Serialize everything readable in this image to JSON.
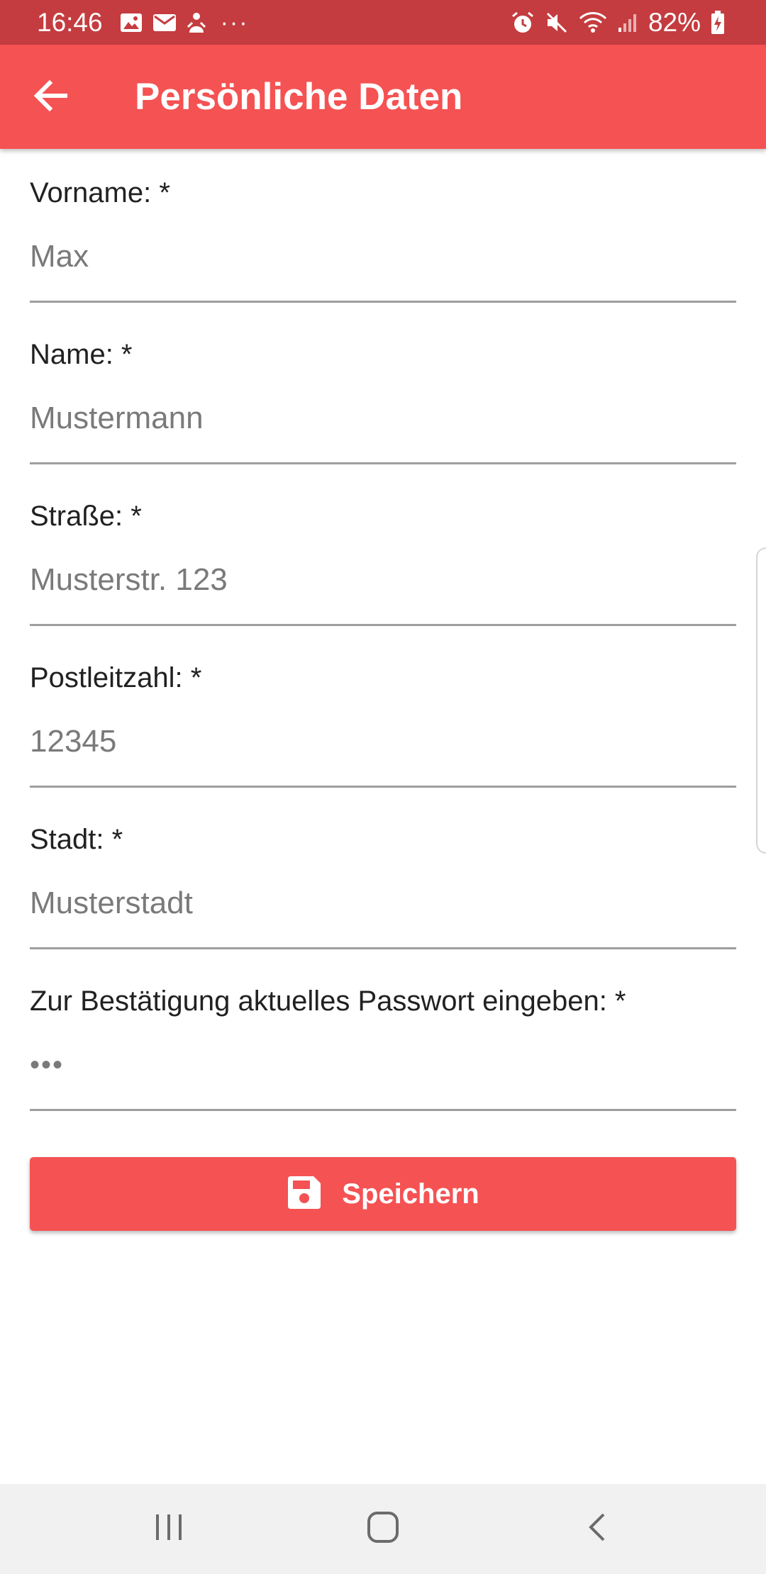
{
  "status_bar": {
    "time": "16:46",
    "battery": "82%",
    "left_icons": [
      "image-icon",
      "mail-icon",
      "notification-icon"
    ],
    "right_icons": [
      "alarm-icon",
      "mute-icon",
      "wifi-icon",
      "signal-icon",
      "battery-charging-icon"
    ]
  },
  "app_bar": {
    "title": "Persönliche Daten",
    "back_icon": "arrow-back-icon",
    "background": "#f55253"
  },
  "form": {
    "fields": [
      {
        "label": "Vorname: *",
        "value": "Max"
      },
      {
        "label": "Name: *",
        "value": "Mustermann"
      },
      {
        "label": "Straße: *",
        "value": "Musterstr. 123"
      },
      {
        "label": "Postleitzahl: *",
        "value": "12345"
      },
      {
        "label": "Stadt: *",
        "value": "Musterstadt"
      },
      {
        "label": "Zur Bestätigung aktuelles Passwort eingeben: *",
        "value": "•••"
      }
    ]
  },
  "save_button": {
    "label": "Speichern",
    "icon": "save-icon"
  },
  "nav_bar": {
    "buttons": [
      "recent-apps-icon",
      "home-icon",
      "back-icon"
    ]
  },
  "colors": {
    "accent": "#f55253",
    "status_bar": "#c43c3f",
    "nav_bar": "#f1f1f1"
  }
}
